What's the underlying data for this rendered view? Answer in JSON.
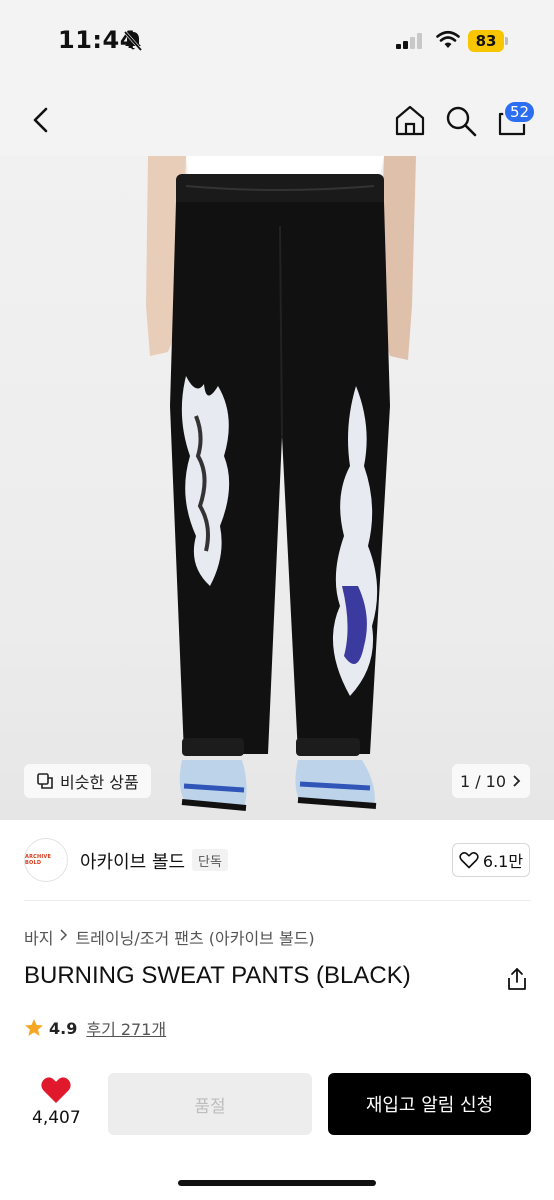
{
  "status_bar": {
    "time": "11:44",
    "battery": "83",
    "icons": [
      "bell-off-icon",
      "signal-icon",
      "wifi-icon",
      "battery-icon"
    ]
  },
  "nav": {
    "icons": [
      "back-icon",
      "home-icon",
      "search-icon",
      "cart-icon"
    ],
    "cart_badge": "52"
  },
  "gallery": {
    "similar_label": "비슷한 상품",
    "page_indicator": "1 / 10"
  },
  "brand": {
    "logo_text": "ARCHIVE BOLD",
    "name": "아카이브 볼드",
    "tag": "단독",
    "likes": "6.1만"
  },
  "breadcrumb": {
    "category": "바지",
    "subcategory": "트레이닝/조거 팬츠 (아카이브 볼드)"
  },
  "product": {
    "title": "BURNING SWEAT PANTS (BLACK)",
    "rating": "4.9",
    "reviews": "후기 271개"
  },
  "bottom_bar": {
    "heart_count": "4,407",
    "soldout_label": "품절",
    "restock_label": "재입고 알림 신청"
  },
  "colors": {
    "accent_blue": "#2c6ef2",
    "heart_red": "#e0192c",
    "star_orange": "#f5a623",
    "battery_yellow": "#f7c600"
  }
}
